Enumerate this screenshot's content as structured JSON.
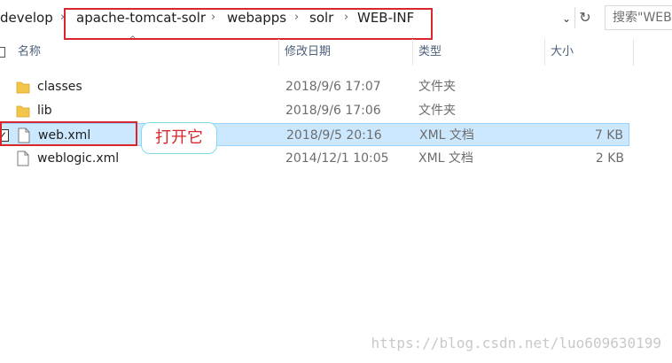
{
  "address_bar": {
    "crumbs": [
      "develop",
      "apache-tomcat-solr",
      "webapps",
      "solr",
      "WEB-INF"
    ],
    "search_placeholder": "搜索\"WEB-INF\""
  },
  "columns": {
    "name": "名称",
    "date": "修改日期",
    "type": "类型",
    "size": "大小"
  },
  "files": [
    {
      "name": "classes",
      "date": "2018/9/6 17:07",
      "type": "文件夹",
      "size": "",
      "icon": "folder-icon"
    },
    {
      "name": "lib",
      "date": "2018/9/6 17:06",
      "type": "文件夹",
      "size": "",
      "icon": "folder-icon"
    },
    {
      "name": "web.xml",
      "date": "2018/9/5 20:16",
      "type": "XML 文档",
      "size": "7 KB",
      "icon": "document-icon",
      "selected": true
    },
    {
      "name": "weblogic.xml",
      "date": "2014/12/1 10:05",
      "type": "XML 文档",
      "size": "2 KB",
      "icon": "document-icon"
    }
  ],
  "annotation": {
    "callout_text": "打开它",
    "highlight_color": "#d9262c"
  },
  "watermark": "https://blog.csdn.net/luo609630199",
  "colors": {
    "selection": "#cce8ff",
    "selection_border": "#99d1ff",
    "folder": "#f3c54a",
    "header_text": "#4c607a"
  }
}
